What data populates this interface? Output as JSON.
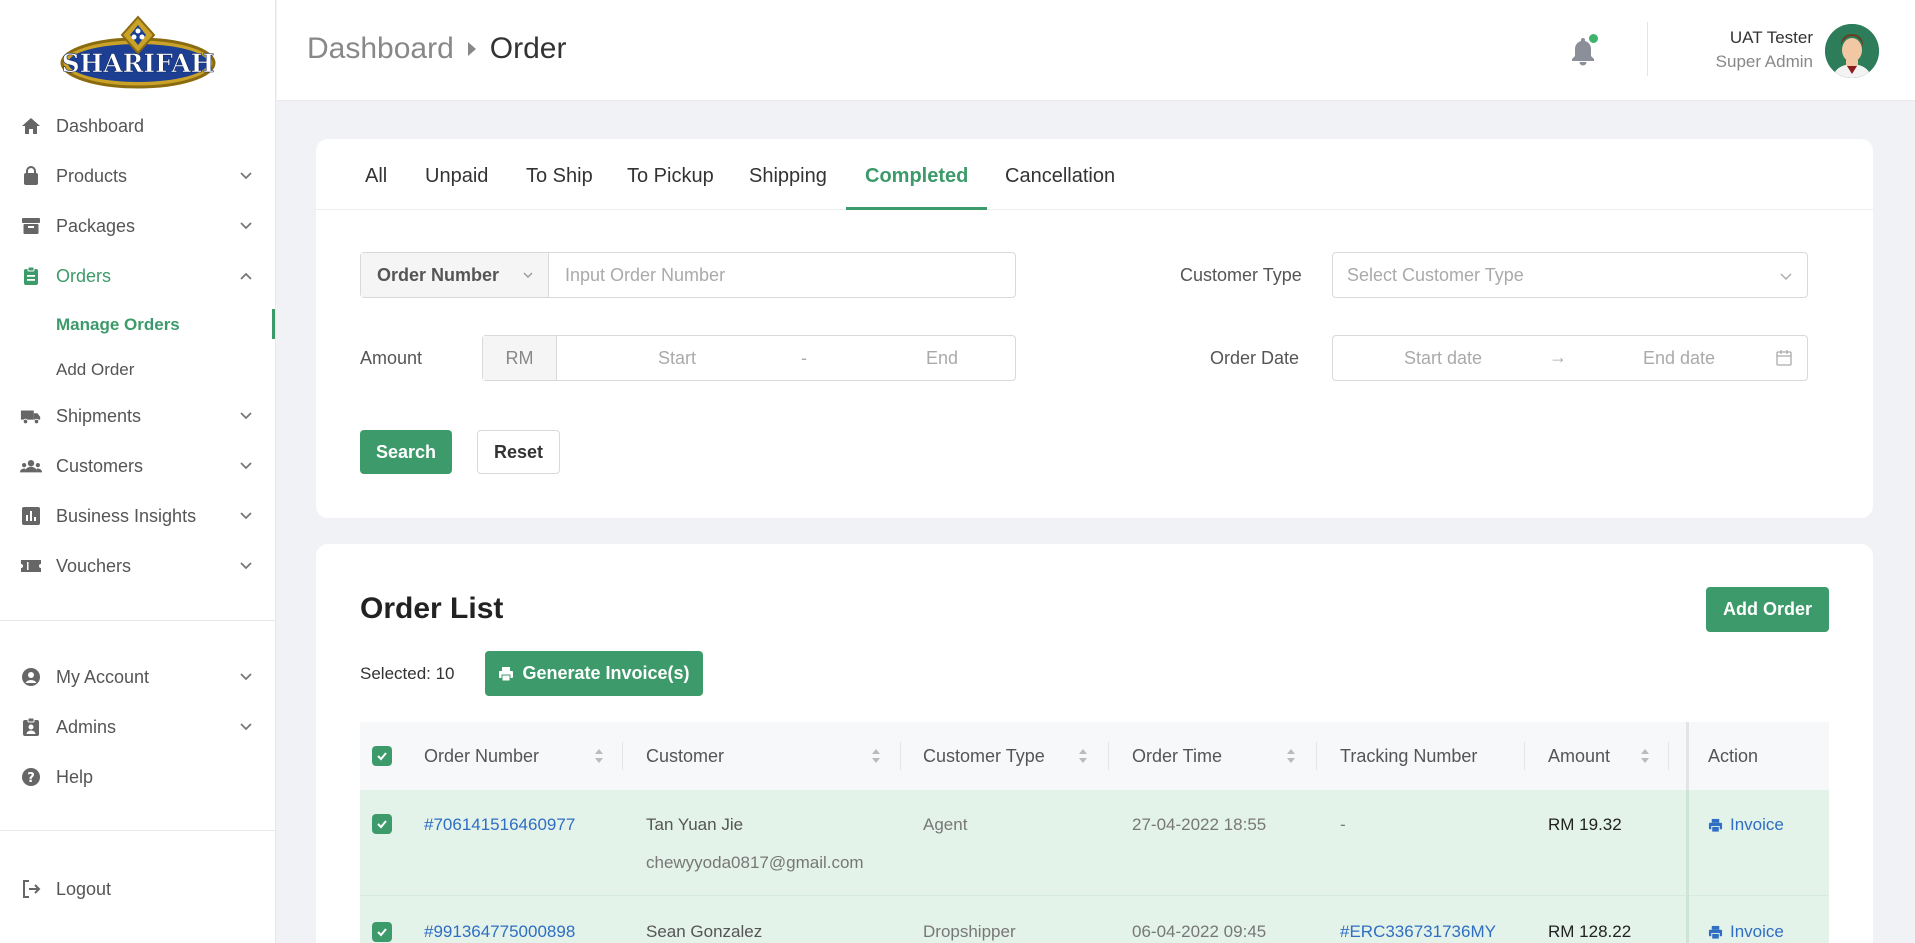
{
  "brand": {
    "logo_text": "SHARIFAH"
  },
  "sidebar": {
    "items": [
      {
        "label": "Dashboard"
      },
      {
        "label": "Products"
      },
      {
        "label": "Packages"
      },
      {
        "label": "Orders"
      },
      {
        "label": "Shipments"
      },
      {
        "label": "Customers"
      },
      {
        "label": "Business Insights"
      },
      {
        "label": "Vouchers"
      }
    ],
    "orders_sub": [
      {
        "label": "Manage Orders"
      },
      {
        "label": "Add Order"
      }
    ],
    "bottom": [
      {
        "label": "My Account"
      },
      {
        "label": "Admins"
      },
      {
        "label": "Help"
      }
    ],
    "logout": "Logout"
  },
  "header": {
    "breadcrumb": [
      "Dashboard",
      "Order"
    ],
    "user_name": "UAT Tester",
    "user_role": "Super Admin"
  },
  "tabs": [
    "All",
    "Unpaid",
    "To Ship",
    "To Pickup",
    "Shipping",
    "Completed",
    "Cancellation"
  ],
  "active_tab": "Completed",
  "filters": {
    "order_number_select": "Order Number",
    "order_number_placeholder": "Input Order Number",
    "customer_type_label": "Customer Type",
    "customer_type_placeholder": "Select Customer Type",
    "amount_label": "Amount",
    "currency": "RM",
    "amount_start": "Start",
    "amount_dash": "-",
    "amount_end": "End",
    "order_date_label": "Order Date",
    "start_date": "Start date",
    "date_arrow": "→",
    "end_date": "End date",
    "search": "Search",
    "reset": "Reset"
  },
  "order_list": {
    "title": "Order List",
    "add_order": "Add Order",
    "selected": "Selected: 10",
    "generate_invoice": "Generate Invoice(s)",
    "columns": [
      "Order Number",
      "Customer",
      "Customer Type",
      "Order Time",
      "Tracking Number",
      "Amount",
      "Action"
    ],
    "rows": [
      {
        "order_number": "#706141516460977",
        "customer": "Tan Yuan Jie",
        "email": "chewyyoda0817@gmail.com",
        "type": "Agent",
        "time": "27-04-2022 18:55",
        "tracking": "-",
        "amount": "RM 19.32",
        "action": "Invoice"
      },
      {
        "order_number": "#991364775000898",
        "customer": "Sean Gonzalez",
        "email": "",
        "type": "Dropshipper",
        "time": "06-04-2022 09:45",
        "tracking": "#ERC336731736MY",
        "amount": "RM 128.22",
        "action": "Invoice"
      }
    ]
  },
  "colors": {
    "accent": "#3d9a6a",
    "link": "#2f6ec2",
    "row_selected": "#e4f3ea"
  }
}
